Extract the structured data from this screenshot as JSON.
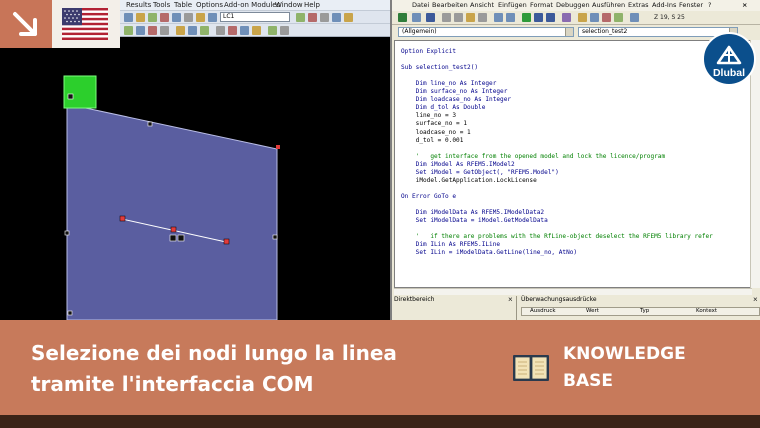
{
  "rfem": {
    "menu": [
      "Results",
      "Tools",
      "Table",
      "Options",
      "Add-on Modules",
      "Window",
      "Help"
    ],
    "load_case": "LC1"
  },
  "vba": {
    "menu": [
      "Datei",
      "Bearbeiten",
      "Ansicht",
      "Einfügen",
      "Format",
      "Debuggen",
      "Ausführen",
      "Extras",
      "Add-Ins",
      "Fenster",
      "?"
    ],
    "cursor_position": "Z 19, S 25",
    "object_combo": "(Allgemein)",
    "procedure_combo": "selection_test2",
    "code_lines": [
      {
        "text": "Option Explicit",
        "style": "kw"
      },
      {
        "text": "",
        "style": "tx"
      },
      {
        "text": "Sub selection_test2()",
        "style": "kw"
      },
      {
        "text": "",
        "style": "tx"
      },
      {
        "text": "    Dim line_no As Integer",
        "style": "kw"
      },
      {
        "text": "    Dim surface_no As Integer",
        "style": "kw"
      },
      {
        "text": "    Dim loadcase_no As Integer",
        "style": "kw"
      },
      {
        "text": "    Dim d_tol As Double",
        "style": "kw"
      },
      {
        "text": "    line_no = 3",
        "style": "tx"
      },
      {
        "text": "    surface_no = 1",
        "style": "tx"
      },
      {
        "text": "    loadcase_no = 1",
        "style": "tx"
      },
      {
        "text": "    d_tol = 0.001",
        "style": "tx"
      },
      {
        "text": "",
        "style": "tx"
      },
      {
        "text": "    '   get interface from the opened model and lock the licence/program",
        "style": "cm"
      },
      {
        "text": "    Dim iModel As RFEM5.IModel2",
        "style": "kw"
      },
      {
        "text": "    Set iModel = GetObject(, \"RFEM5.Model\")",
        "style": "kw"
      },
      {
        "text": "    iModel.GetApplication.LockLicense",
        "style": "tx"
      },
      {
        "text": "",
        "style": "tx"
      },
      {
        "text": "On Error GoTo e",
        "style": "kw"
      },
      {
        "text": "",
        "style": "tx"
      },
      {
        "text": "    Dim iModelData As RFEM5.IModelData2",
        "style": "kw"
      },
      {
        "text": "    Set iModelData = iModel.GetModelData",
        "style": "kw"
      },
      {
        "text": "",
        "style": "tx"
      },
      {
        "text": "    '   if there are problems with the RfLine-object deselect the RFEM5 library refer",
        "style": "cm"
      },
      {
        "text": "    Dim ILin As RFEM5.ILine",
        "style": "kw"
      },
      {
        "text": "    Set ILin = iModelData.GetLine(line_no, AtNo)",
        "style": "kw"
      }
    ],
    "direct_pane_title": "Direktbereich",
    "watch_pane_title": "Überwachungsausdrücke",
    "watch_columns": [
      "Ausdruck",
      "Wert",
      "Typ",
      "Kontext"
    ]
  },
  "branding": {
    "logo_text": "Dlubal",
    "flag": "us-flag-icon",
    "corner_icon": "arrow-down-right-icon",
    "accent_color": "#c77a5b",
    "logo_color": "#0b4f8c"
  },
  "banner": {
    "title_line_1": "Selezione dei nodi lungo la linea",
    "title_line_2": "tramite l'interfaccia COM",
    "kb_line_1": "KNOWLEDGE",
    "kb_line_2": "BASE",
    "kb_icon": "open-book-icon"
  }
}
